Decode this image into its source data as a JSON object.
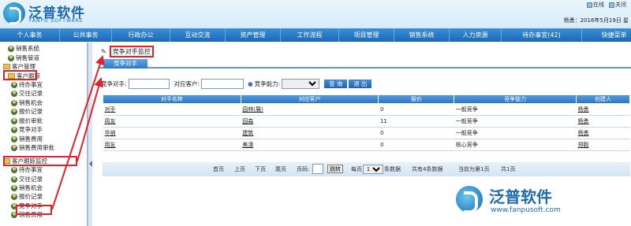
{
  "header": {
    "logo_cn": "泛普软件",
    "logo_en": "FANPU SOFTWARE",
    "links": [
      "在线",
      "关闭"
    ],
    "date": "杨勇：2016年5月19日 星"
  },
  "nav": [
    "个人事务",
    "公共事务",
    "行政办公",
    "互动交流",
    "资产管理",
    "工作流程",
    "项目管理",
    "销售系统",
    "人力资源",
    "待办事宜(42)",
    "快捷菜单"
  ],
  "sidebar": {
    "items": [
      "销售系统",
      "销售管道",
      "客户管理",
      "客户跟踪",
      "待办事宜",
      "交往记录",
      "销售机会",
      "报价记录",
      "报价审批",
      "竞争对手",
      "销售费用",
      "销售费用审批",
      "客户跟踪监控",
      "待办事宜",
      "交往记录",
      "销售机会",
      "报价记录",
      "竞争对手",
      "销售费用"
    ]
  },
  "main": {
    "breadcrumb": "竞争对手监控",
    "tab": "竞争对手",
    "filter": {
      "label1": "竞争对手:",
      "label2": "对应客户:",
      "label3": "竞争能力:",
      "query": "查 询",
      "export": "退 出"
    },
    "columns": [
      "对手名称",
      "对应客户",
      "报价",
      "竞争能力",
      "创建人"
    ],
    "rows": [
      [
        "对手",
        "园林(展)",
        "0",
        "一般竞争",
        "杨勇"
      ],
      [
        "周友",
        "园森",
        "11",
        "一般竞争",
        "杨勇"
      ],
      [
        "华纳",
        "建筑",
        "0",
        "一般竞争",
        "杨勇"
      ],
      [
        "用友",
        "美濠",
        "0",
        "核心竞争",
        "郑毅"
      ]
    ],
    "pager": {
      "first": "首页",
      "prev": "上页",
      "next": "下页",
      "last": "尾页",
      "page_label": "页码:",
      "go": "跳转",
      "per": "每页",
      "per_val": "100",
      "per_unit": "条数据",
      "total": "共有4条数据",
      "current": "当前为第1页",
      "pages": "共1页"
    }
  },
  "watermark": {
    "text": "泛普软件",
    "url": "www.fanpusoft.com"
  }
}
